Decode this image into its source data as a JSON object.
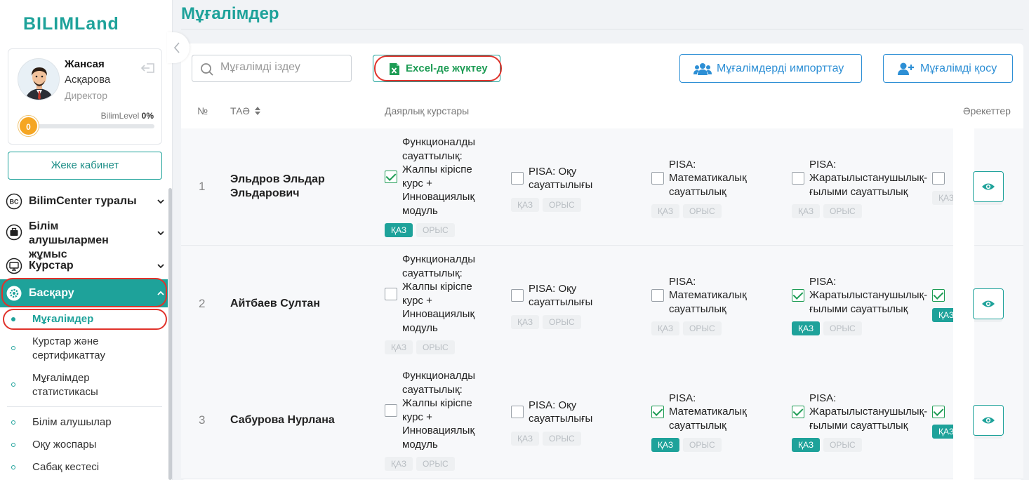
{
  "app": {
    "logo": "BILIMLand"
  },
  "profile": {
    "first_name": "Жансая",
    "last_name": "Асқарова",
    "role": "Директор",
    "level_label": "BilimLevel",
    "level_percent": "0%",
    "level_badge": "0",
    "level_progress": 0,
    "cabinet_button": "Жеке кабинет"
  },
  "sidebar": {
    "items": [
      {
        "label": "BilimCenter туралы",
        "icon": "bc-icon"
      },
      {
        "label": "Білім алушылармен жұмыс",
        "icon": "briefcase-icon"
      },
      {
        "label": "Курстар",
        "icon": "monitor-icon"
      },
      {
        "label": "Басқару",
        "icon": "gear-icon"
      }
    ],
    "subitems": [
      {
        "label": "Мұғалімдер"
      },
      {
        "label": "Курстар және сертификаттау"
      },
      {
        "label": "Мұғалімдер статистикасы"
      },
      {
        "label": "Білім алушылар"
      },
      {
        "label": "Оқу жоспары"
      },
      {
        "label": "Сабақ кестесі"
      }
    ]
  },
  "page": {
    "title": "Мұғалімдер"
  },
  "toolbar": {
    "search_placeholder": "Мұғалімді іздеу",
    "excel_label": "Excel-де жүктеу",
    "import_label": "Мұғалімдерді импорттау",
    "add_label": "Мұғалімді қосу"
  },
  "table": {
    "headers": {
      "no": "№",
      "name": "ТАӘ",
      "courses": "Даярлық курстары",
      "actions": "Әрекеттер"
    },
    "tags": {
      "kaz": "ҚАЗ",
      "rus": "ОРЫС"
    },
    "course_names": [
      "Функционалды\nсауаттылық:\nЖалпы кіріспе\nкурс +\nИнновациялық\nмодуль",
      "PISA: Оқу\nсауаттылығы",
      "PISA:\nМатематикалық\nсауаттылық",
      "PISA:\nЖаратылыстанушылық-\nғылыми сауаттылық"
    ],
    "rows": [
      {
        "no": "1",
        "name": "Эльдров Эльдар Эльдарович",
        "checked": [
          true,
          false,
          false,
          false,
          false
        ],
        "kaz": [
          true,
          false,
          false,
          false,
          false
        ]
      },
      {
        "no": "2",
        "name": "Айтбаев Султан",
        "checked": [
          false,
          false,
          false,
          true,
          true
        ],
        "kaz": [
          false,
          false,
          false,
          true,
          true
        ]
      },
      {
        "no": "3",
        "name": "Сабурова Нурлана",
        "checked": [
          false,
          false,
          true,
          true,
          true
        ],
        "kaz": [
          false,
          false,
          true,
          true,
          true
        ]
      }
    ]
  },
  "colors": {
    "accent": "#1ea29a",
    "blue": "#2d8fd5",
    "excel_green": "#1e9c55",
    "level_orange": "#f5a623",
    "highlight_red": "#e0322b"
  }
}
